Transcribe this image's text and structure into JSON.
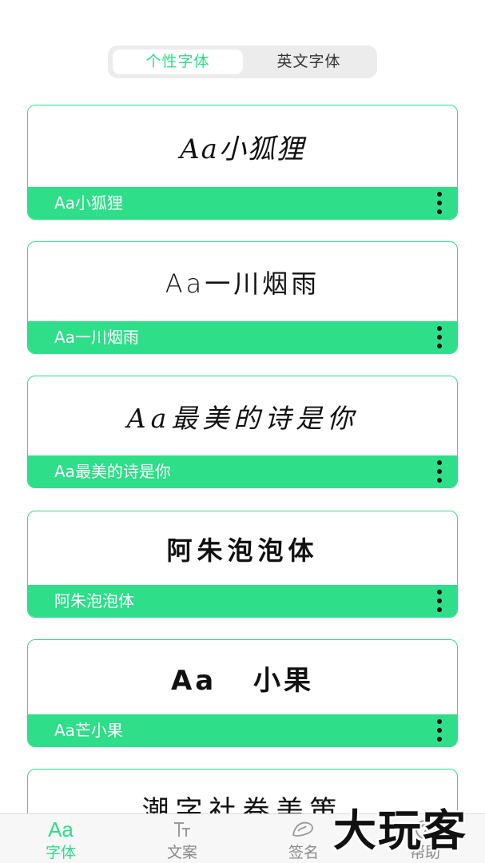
{
  "segment": {
    "tabs": [
      "个性字体",
      "英文字体"
    ],
    "active": 0
  },
  "fonts": [
    {
      "preview": "Aa小狐狸",
      "name": "Aa小狐狸"
    },
    {
      "preview": "Aa一川烟雨",
      "name": "Aa一川烟雨"
    },
    {
      "preview": "Aa最美的诗是你",
      "name": "Aa最美的诗是你"
    },
    {
      "preview": "阿朱泡泡体",
      "name": "阿朱泡泡体"
    },
    {
      "preview": "Aa 小果",
      "name": "Aa芒小果"
    },
    {
      "preview": "潮字社卷美策",
      "name": ""
    }
  ],
  "tabbar": {
    "items": [
      {
        "label": "字体",
        "icon": "font-aa-icon"
      },
      {
        "label": "文案",
        "icon": "text-tt-icon"
      },
      {
        "label": "签名",
        "icon": "signature-icon"
      },
      {
        "label": "帮助",
        "icon": "help-icon"
      }
    ]
  },
  "colors": {
    "accent": "#2ede89",
    "inactive": "#888888"
  },
  "watermark": "大玩客"
}
